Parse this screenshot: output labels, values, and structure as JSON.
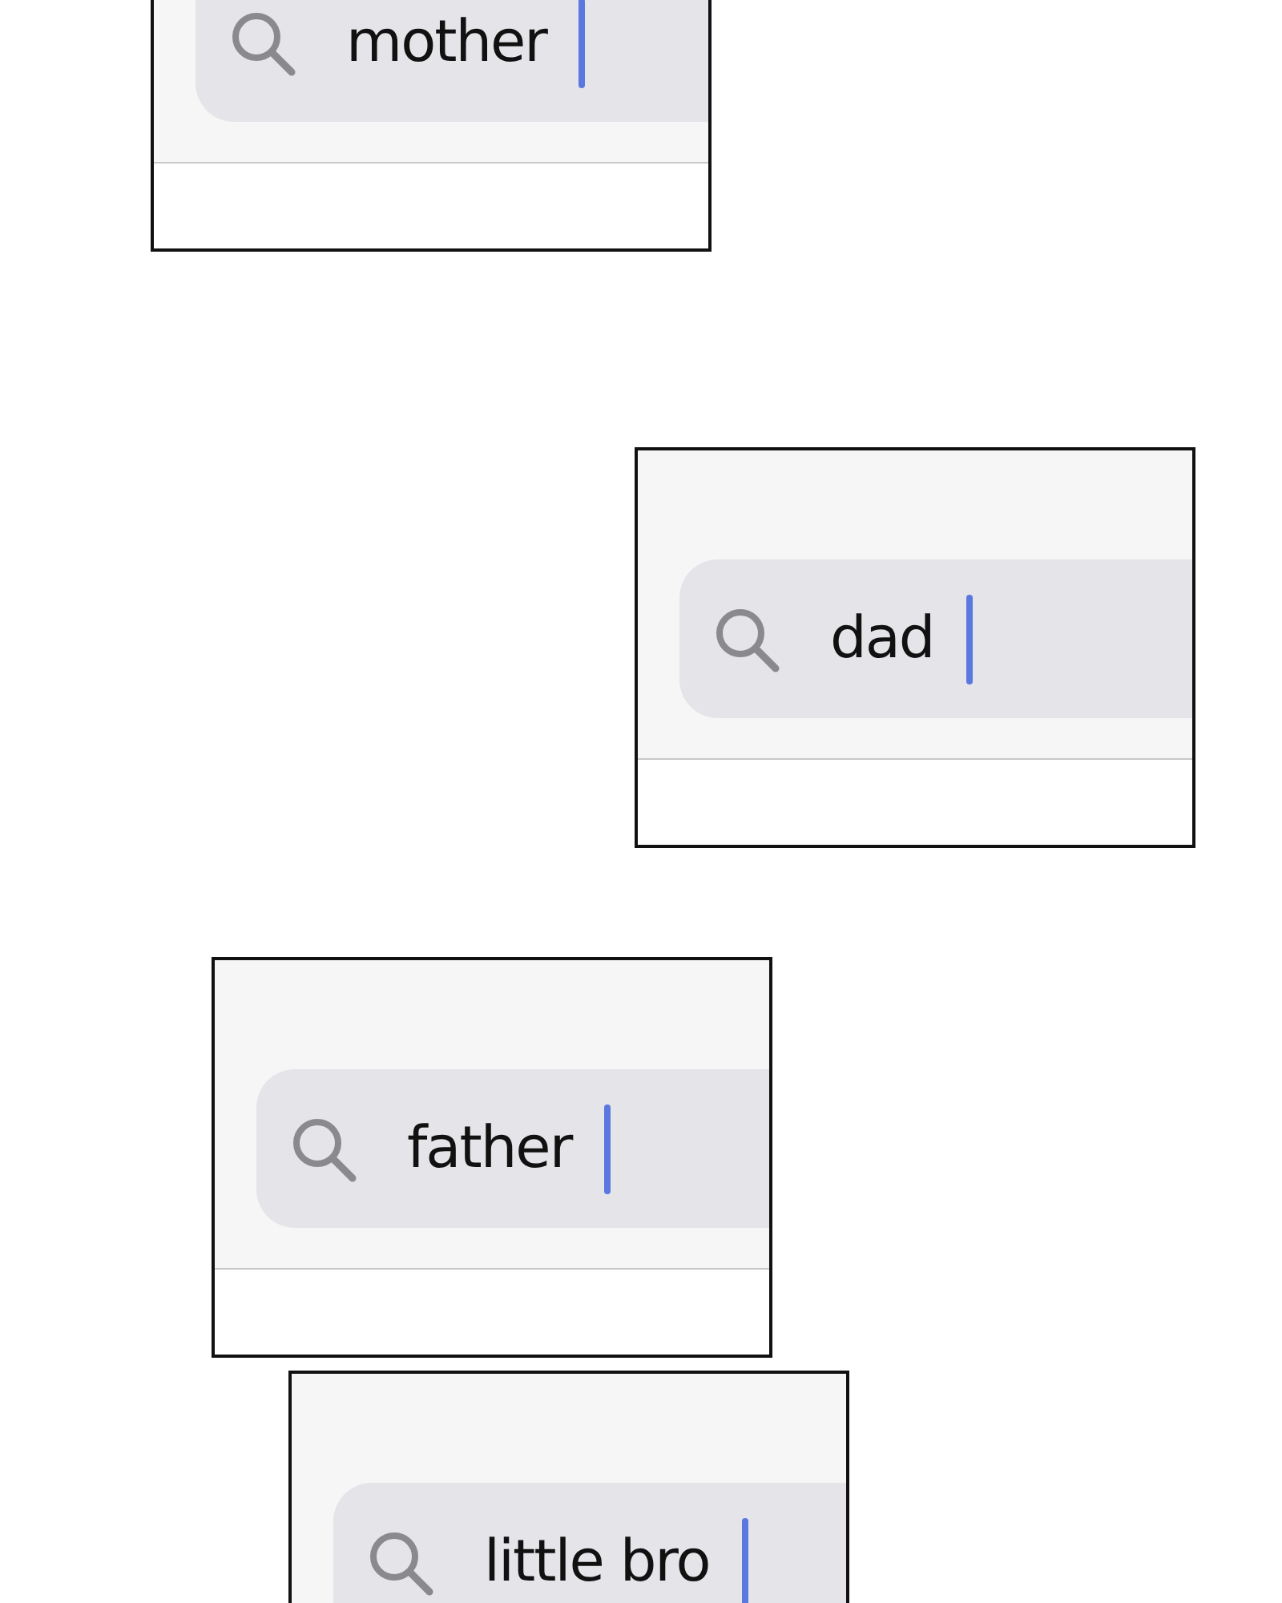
{
  "panels": [
    {
      "query": "mother"
    },
    {
      "query": "dad"
    },
    {
      "query": "father"
    },
    {
      "query": "little bro"
    }
  ]
}
